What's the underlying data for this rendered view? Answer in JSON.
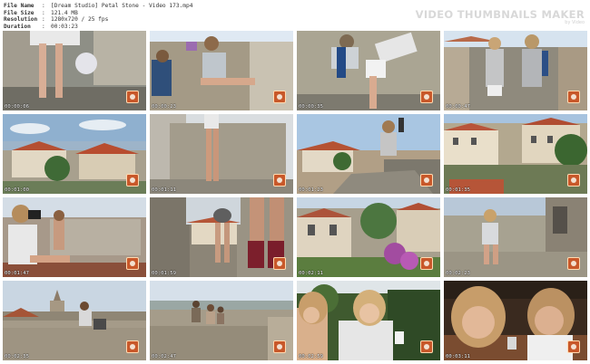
{
  "header": {
    "file_name": {
      "key": "File Name",
      "value": "[Dream Studio] Petal Stone - Video 173.mp4"
    },
    "file_size": {
      "key": "File Size",
      "value": "121.4 MB"
    },
    "resolution": {
      "key": "Resolution",
      "value": "1280x720 / 25 fps"
    },
    "duration": {
      "key": "Duration",
      "value": "00:03:23"
    },
    "separator": ":"
  },
  "watermark": {
    "title": "VIDEO THUMBNAILS MAKER",
    "subtitle": "by Video"
  },
  "thumbnails": [
    {
      "timestamp": "00:00:06",
      "scene": "stairs-legs"
    },
    {
      "timestamp": "00:00:23",
      "scene": "wall-two-girls"
    },
    {
      "timestamp": "00:00:35",
      "scene": "wall-lean"
    },
    {
      "timestamp": "00:00:47",
      "scene": "street-two-girls"
    },
    {
      "timestamp": "00:01:00",
      "scene": "village-rooftops"
    },
    {
      "timestamp": "00:01:11",
      "scene": "wall-legs"
    },
    {
      "timestamp": "00:01:23",
      "scene": "rock-sitting-camera"
    },
    {
      "timestamp": "00:01:35",
      "scene": "town-houses"
    },
    {
      "timestamp": "00:01:47",
      "scene": "wall-photographer"
    },
    {
      "timestamp": "00:01:59",
      "scene": "wall-alley-legs"
    },
    {
      "timestamp": "00:02:11",
      "scene": "village-flowers"
    },
    {
      "timestamp": "00:02:23",
      "scene": "wall-sitting-girl"
    },
    {
      "timestamp": "00:02:35",
      "scene": "fortress-wall"
    },
    {
      "timestamp": "00:02:47",
      "scene": "fortress-people"
    },
    {
      "timestamp": "00:02:59",
      "scene": "cafe-girls"
    },
    {
      "timestamp": "00:03:11",
      "scene": "close-up-girls"
    }
  ]
}
